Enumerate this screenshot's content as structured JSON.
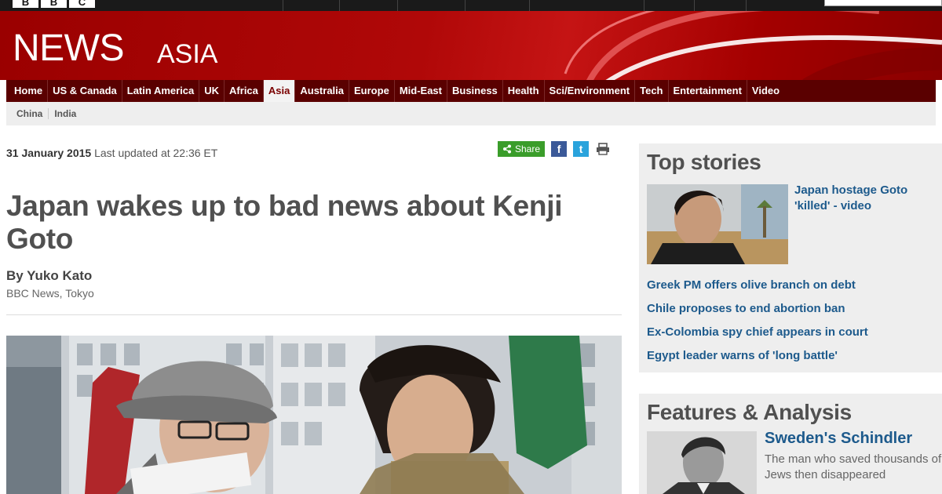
{
  "logo": {
    "letters": [
      "B",
      "B",
      "C"
    ]
  },
  "masthead": {
    "title": "NEWS",
    "edition": "ASIA"
  },
  "nav": {
    "items": [
      "Home",
      "US & Canada",
      "Latin America",
      "UK",
      "Africa",
      "Asia",
      "Australia",
      "Europe",
      "Mid-East",
      "Business",
      "Health",
      "Sci/Environment",
      "Tech",
      "Entertainment",
      "Video"
    ],
    "active": "Asia"
  },
  "subnav": {
    "items": [
      "China",
      "India"
    ]
  },
  "article": {
    "date": "31 January 2015",
    "updated": "Last updated at 22:36 ET",
    "share_label": "Share",
    "headline": "Japan wakes up to bad news about Kenji Goto",
    "byline": "By Yuko Kato",
    "byline_role": "BBC News, Tokyo"
  },
  "share_icons": {
    "facebook": "f",
    "twitter": "t"
  },
  "top_stories": {
    "heading": "Top stories",
    "lead_link": "Japan hostage Goto 'killed' - video",
    "links": [
      "Greek PM offers olive branch on debt",
      "Chile proposes to end abortion ban",
      "Ex-Colombia spy chief appears in court",
      "Egypt leader warns of 'long battle'"
    ]
  },
  "features": {
    "heading": "Features & Analysis",
    "title": "Sweden's Schindler",
    "subtitle_line1": "The man who saved thousands of",
    "subtitle_line2": "Jews then disappeared"
  },
  "colors": {
    "brand_red": "#b00808",
    "nav_dark": "#5a0000",
    "link_blue": "#1d5a8c",
    "share_green": "#3a9d2a"
  }
}
